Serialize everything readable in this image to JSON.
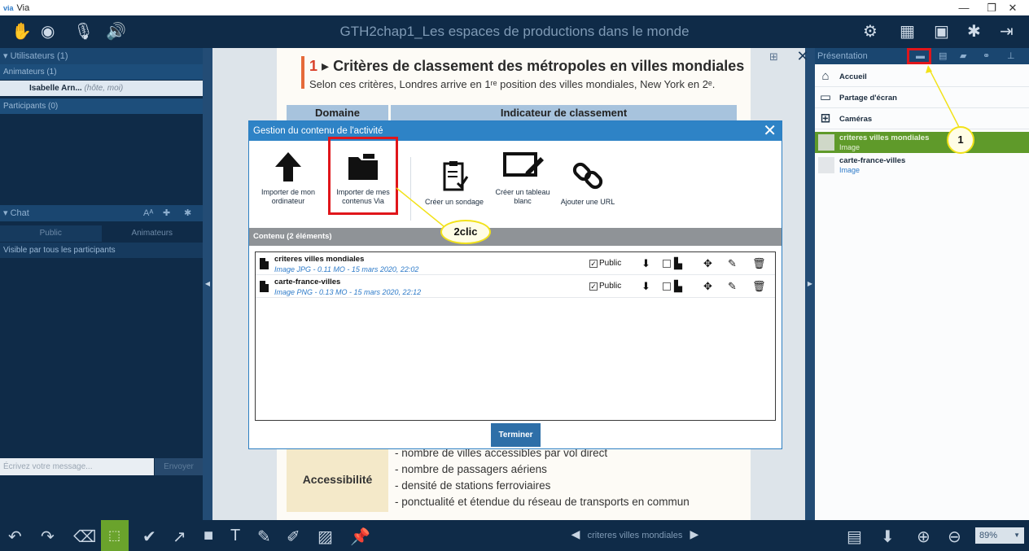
{
  "window": {
    "logo": "via",
    "title": "Via",
    "minimize": "—",
    "restore": "❐",
    "close": "✕"
  },
  "toolbar": {
    "session_title": "GTH2chap1_Les espaces de productions dans le monde"
  },
  "users_panel": {
    "header": "Utilisateurs (1)",
    "animators_label": "Animateurs (1)",
    "user_name": "Isabelle Arn...",
    "user_role": "(hôte, moi)",
    "participants_label": "Participants (0)"
  },
  "chat_panel": {
    "header": "Chat",
    "font_button": "Aᴬ",
    "tabs": [
      "Public",
      "Animateurs"
    ],
    "visibility_label": "Visible par tous les participants",
    "message_placeholder": "Écrivez votre message...",
    "send_label": "Envoyer"
  },
  "document": {
    "section_number": "1",
    "heading": "Critères de classement des métropoles en villes mondiales",
    "subheading": "Selon ces critères, Londres arrive en 1ʳᵉ position des villes mondiales, New York en 2ᵉ.",
    "table_header_left": "Domaine",
    "table_header_right": "Indicateur de classement",
    "row_label": "Accessibilité",
    "row_lines": [
      "- nombre de villes accessibles par vol direct",
      "- nombre de passagers aériens",
      "- densité de stations ferroviaires",
      "- ponctualité et étendue du réseau de transports en commun"
    ]
  },
  "presentation_panel": {
    "header": "Présentation",
    "items": [
      {
        "label": "Accueil",
        "icon": "home-icon"
      },
      {
        "label": "Partage d'écran",
        "icon": "screen-icon"
      },
      {
        "label": "Caméras",
        "icon": "cameras-icon"
      }
    ],
    "images": [
      {
        "title": "criteres villes mondiales",
        "type": "Image",
        "selected": true
      },
      {
        "title": "carte-france-villes",
        "type": "Image",
        "selected": false
      }
    ]
  },
  "modal": {
    "title": "Gestion du contenu de l'activité",
    "actions": [
      {
        "label": "Importer de mon ordinateur",
        "icon": "upload-arrow-icon"
      },
      {
        "label": "Importer de mes contenus Via",
        "icon": "folder-icon"
      },
      {
        "label": "Créer un sondage",
        "icon": "survey-clipboard-icon"
      },
      {
        "label": "Créer un tableau blanc",
        "icon": "whiteboard-icon"
      },
      {
        "label": "Ajouter une URL",
        "icon": "link-icon"
      }
    ],
    "content_header": "Contenu (2 éléments)",
    "rows": [
      {
        "name": "criteres villes mondiales",
        "meta": "Image JPG - 0.11 MO - 15 mars 2020, 22:02",
        "public_label": "Public",
        "public_checked": true
      },
      {
        "name": "carte-france-villes",
        "meta": "Image PNG - 0.13 MO - 15 mars 2020, 22:12",
        "public_label": "Public",
        "public_checked": true
      }
    ],
    "finish_label": "Terminer"
  },
  "bottom": {
    "current_doc": "criteres villes mondiales",
    "zoom": "89%"
  },
  "annotations": {
    "callout_1": "1",
    "callout_2": "2clic"
  },
  "colors": {
    "accent_blue": "#2e83c6",
    "highlight_red": "#e0161b",
    "callout_yellow": "#f2e21a",
    "selected_green": "#6aa32c"
  }
}
